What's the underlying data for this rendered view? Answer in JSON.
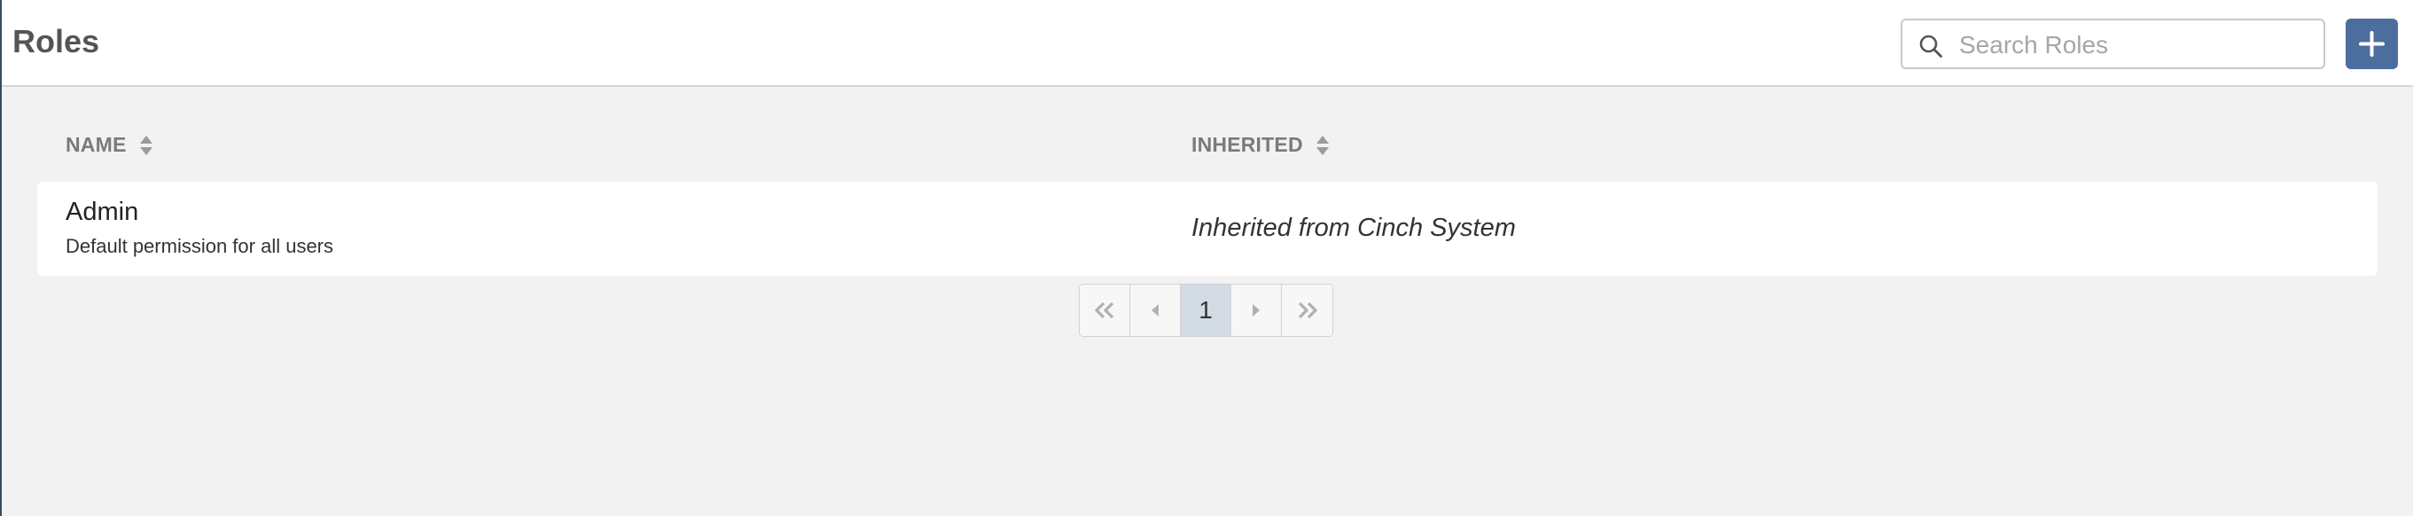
{
  "header": {
    "title": "Roles",
    "search": {
      "placeholder": "Search Roles",
      "value": ""
    },
    "add_button_icon": "plus-icon"
  },
  "table": {
    "columns": [
      {
        "label": "NAME",
        "sort_icon": "sort-icon"
      },
      {
        "label": "INHERITED",
        "sort_icon": "sort-icon"
      }
    ],
    "rows": [
      {
        "name": "Admin",
        "description": "Default permission for all users",
        "inherited": "Inherited from Cinch System"
      }
    ]
  },
  "pagination": {
    "current_page": "1",
    "icons": [
      "first-page-icon",
      "previous-page-icon",
      "next-page-icon",
      "last-page-icon"
    ]
  },
  "colors": {
    "accent": "#4b6e9e",
    "background": "#f2f2f2",
    "current_page_bg": "#d3dbe4"
  }
}
